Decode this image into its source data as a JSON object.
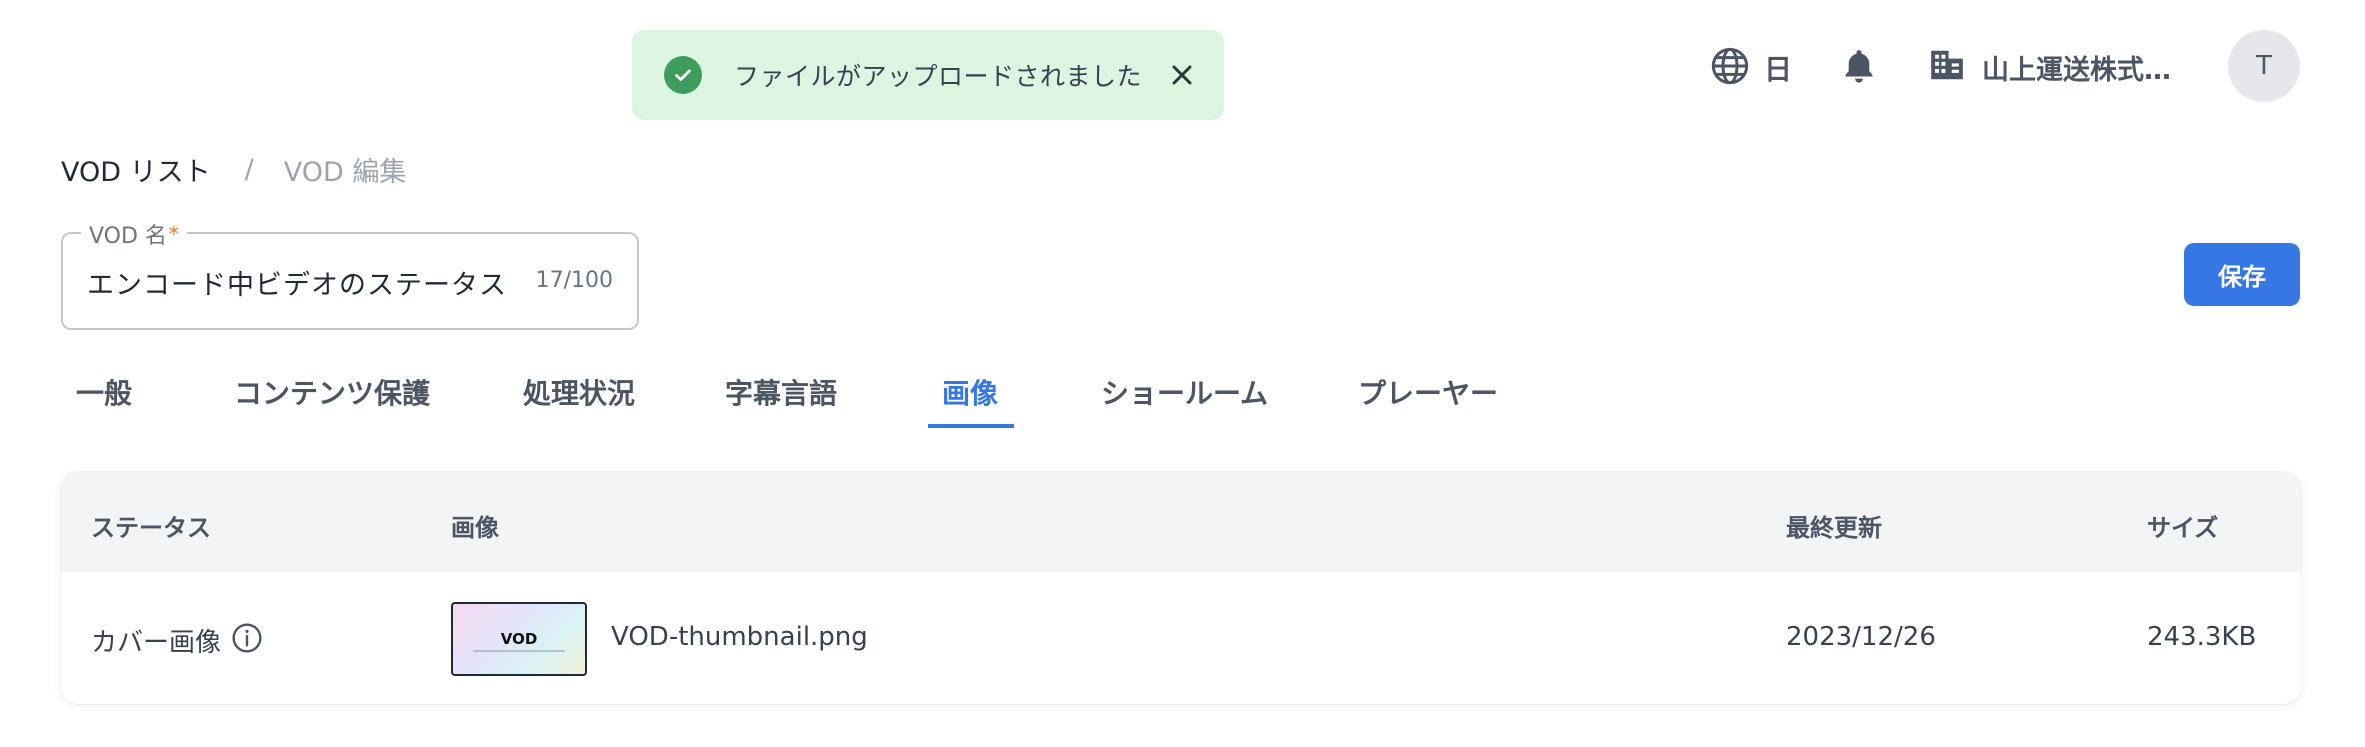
{
  "toast": {
    "message": "ファイルがアップロードされました",
    "icon": "check-circle-icon",
    "close_icon": "close-icon",
    "color": "#dcf5e1"
  },
  "header": {
    "language_label": "日",
    "organization_label": "山上運送株式…",
    "avatar_initial": "T"
  },
  "breadcrumb": {
    "items": [
      {
        "label": "VOD リスト"
      },
      {
        "label": "VOD 編集"
      }
    ],
    "separator": "/"
  },
  "vod_name_field": {
    "label": "VOD 名",
    "required_mark": "*",
    "value": "エンコード中ビデオのステータス",
    "counter": "17/100"
  },
  "save_button": {
    "label": "保存",
    "color": "#3577e5"
  },
  "tabs": [
    {
      "label": "一般"
    },
    {
      "label": "コンテンツ保護"
    },
    {
      "label": "処理状況"
    },
    {
      "label": "字幕言語"
    },
    {
      "label": "画像",
      "active": true
    },
    {
      "label": "ショールーム"
    },
    {
      "label": "プレーヤー"
    }
  ],
  "table": {
    "columns": [
      "ステータス",
      "画像",
      "最終更新",
      "サイズ"
    ],
    "rows": [
      {
        "status": "カバー画像",
        "thumbnail_text": "VOD",
        "filename": "VOD-thumbnail.png",
        "updated": "2023/12/26",
        "size": "243.3KB"
      }
    ]
  }
}
